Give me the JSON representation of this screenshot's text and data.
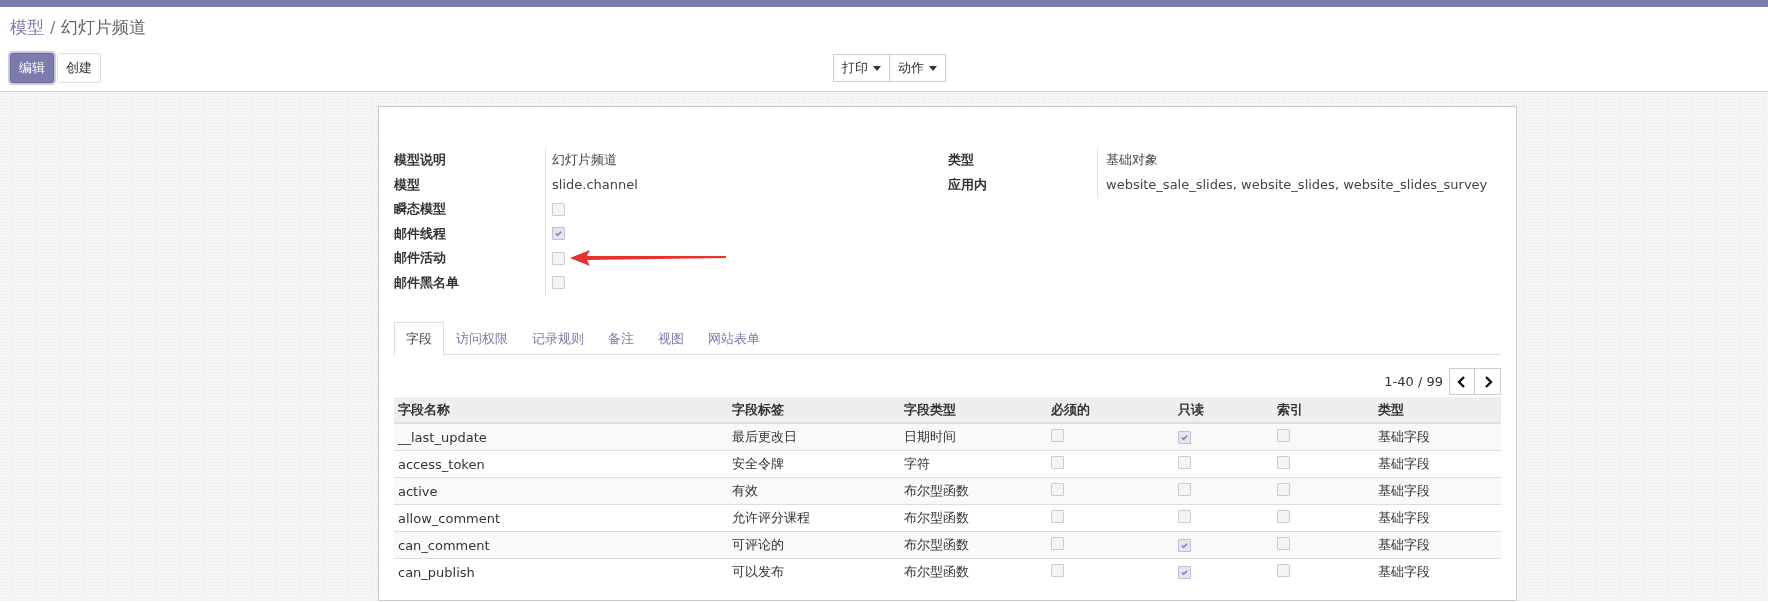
{
  "breadcrumb": [
    {
      "label": "模型",
      "kind": "link"
    },
    {
      "label": "/",
      "kind": "separator"
    },
    {
      "label": "幻灯片频道",
      "kind": "current"
    }
  ],
  "buttons": [
    {
      "label": "编辑",
      "kind": "primary"
    },
    {
      "label": "创建",
      "kind": "secondary"
    }
  ],
  "dropdowns": [
    {
      "label": "打印"
    },
    {
      "label": "动作"
    }
  ],
  "form_left": [
    {
      "label": "模型说明",
      "kind": "text",
      "value": "幻灯片频道"
    },
    {
      "label": "模型",
      "kind": "text",
      "value": "slide.channel"
    },
    {
      "label": "瞬态模型",
      "kind": "checkbox",
      "checked": false
    },
    {
      "label": "邮件线程",
      "kind": "checkbox",
      "checked": true
    },
    {
      "label": "邮件活动",
      "kind": "checkbox",
      "checked": false,
      "annotated": true
    },
    {
      "label": "邮件黑名单",
      "kind": "checkbox",
      "checked": false
    }
  ],
  "form_right": [
    {
      "label": "类型",
      "value": "基础对象"
    },
    {
      "label": "应用内",
      "value": "website_sale_slides, website_slides, website_slides_survey"
    }
  ],
  "tabs": [
    {
      "label": "字段",
      "selected": true
    },
    {
      "label": "访问权限",
      "selected": false
    },
    {
      "label": "记录规则",
      "selected": false
    },
    {
      "label": "备注",
      "selected": false
    },
    {
      "label": "视图",
      "selected": false
    },
    {
      "label": "网站表单",
      "selected": false
    }
  ],
  "pager": {
    "text": "1-40 / 99"
  },
  "table": {
    "columns": [
      "字段名称",
      "字段标签",
      "字段类型",
      "必须的",
      "只读",
      "索引",
      "类型"
    ],
    "rows": [
      {
        "name": "__last_update",
        "label": "最后更改日",
        "type": "日期时间",
        "required": false,
        "readonly": true,
        "index": false,
        "kind": "基础字段"
      },
      {
        "name": "access_token",
        "label": "安全令牌",
        "type": "字符",
        "required": false,
        "readonly": false,
        "index": false,
        "kind": "基础字段"
      },
      {
        "name": "active",
        "label": "有效",
        "type": "布尔型函数",
        "required": false,
        "readonly": false,
        "index": false,
        "kind": "基础字段"
      },
      {
        "name": "allow_comment",
        "label": "允许评分课程",
        "type": "布尔型函数",
        "required": false,
        "readonly": false,
        "index": false,
        "kind": "基础字段"
      },
      {
        "name": "can_comment",
        "label": "可评论的",
        "type": "布尔型函数",
        "required": false,
        "readonly": true,
        "index": false,
        "kind": "基础字段"
      },
      {
        "name": "can_publish",
        "label": "可以发布",
        "type": "布尔型函数",
        "required": false,
        "readonly": true,
        "index": false,
        "kind": "基础字段"
      }
    ]
  }
}
